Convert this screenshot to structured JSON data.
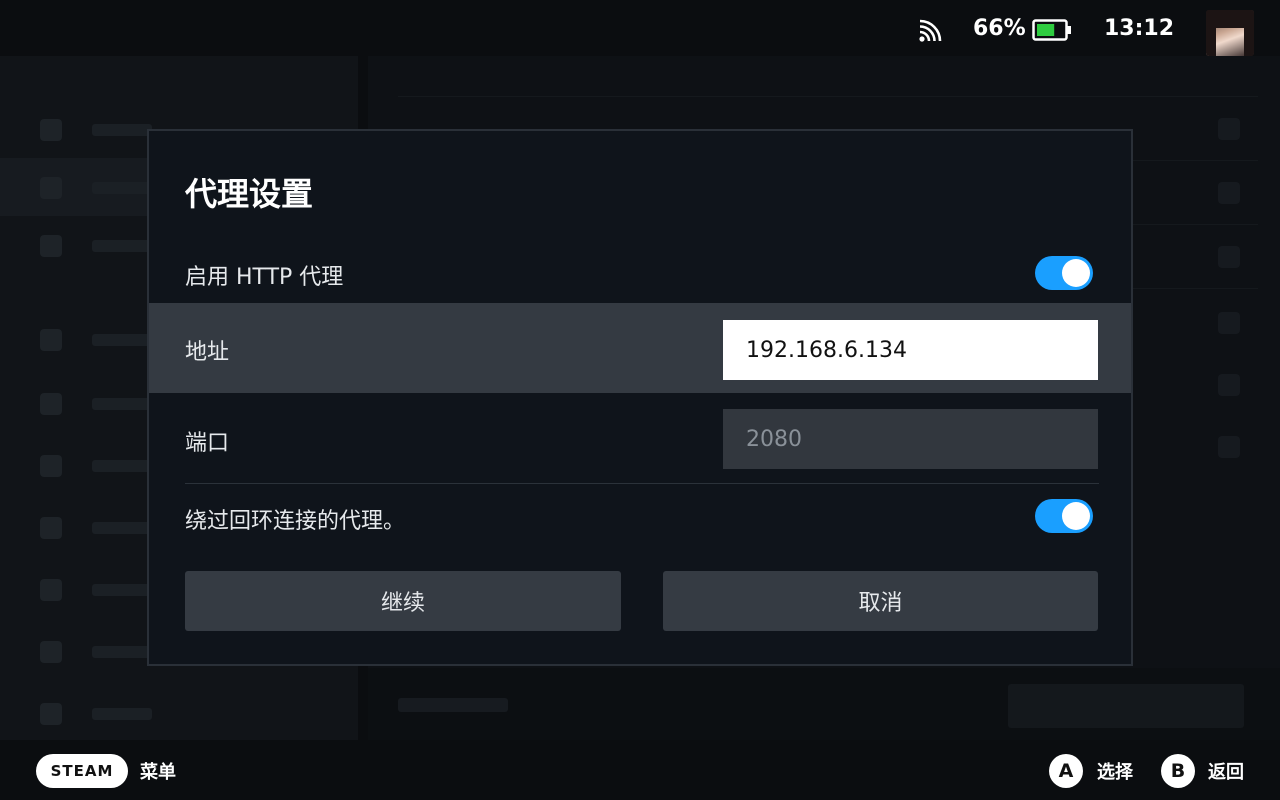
{
  "status": {
    "battery_percent": "66%",
    "battery_level": 0.66,
    "time": "13:12",
    "wifi_icon": "wifi-icon",
    "battery_icon": "battery-icon"
  },
  "dialog": {
    "title": "代理设置",
    "enable_http_proxy": {
      "label": "启用 HTTP 代理",
      "on": true
    },
    "address": {
      "label": "地址",
      "value": "192.168.6.134"
    },
    "port": {
      "label": "端口",
      "placeholder": "2080"
    },
    "bypass_loopback": {
      "label": "绕过回环连接的代理。",
      "on": true
    },
    "continue_label": "继续",
    "cancel_label": "取消"
  },
  "bottombar": {
    "steam_label": "STEAM",
    "menu_label": "菜单",
    "a_button": "A",
    "a_label": "选择",
    "b_button": "B",
    "b_label": "返回"
  },
  "colors": {
    "accent": "#1a9fff",
    "dialog_bg": "#0f141b",
    "selected_row": "#343a42",
    "button_bg": "#353b43"
  }
}
